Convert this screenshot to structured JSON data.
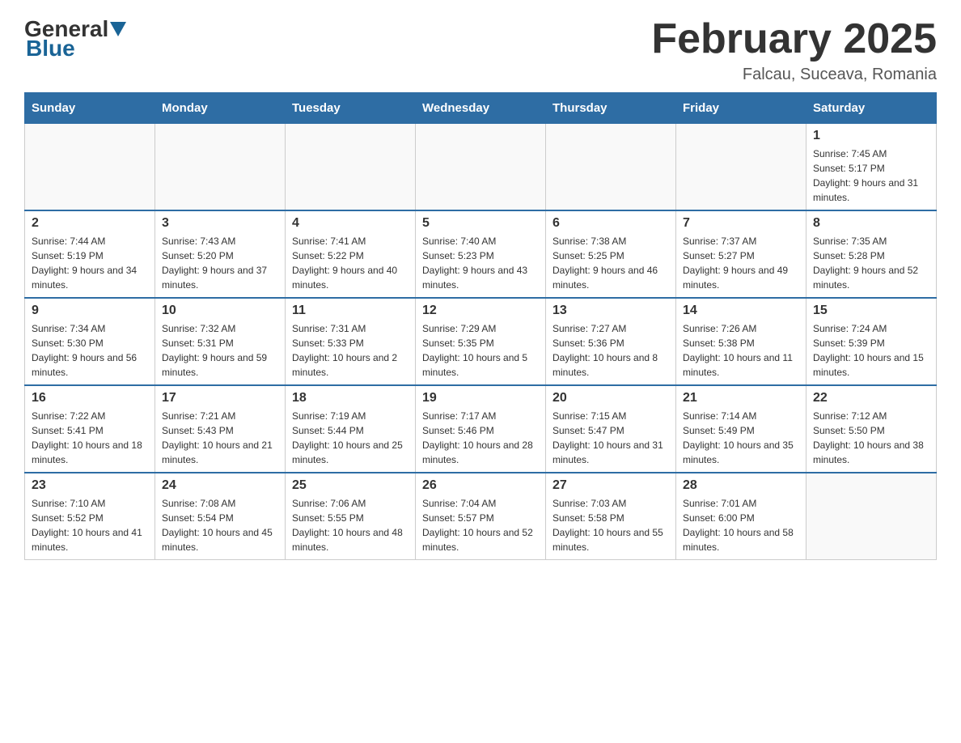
{
  "header": {
    "logo_general": "General",
    "logo_blue": "Blue",
    "month_title": "February 2025",
    "location": "Falcau, Suceava, Romania"
  },
  "weekdays": [
    "Sunday",
    "Monday",
    "Tuesday",
    "Wednesday",
    "Thursday",
    "Friday",
    "Saturday"
  ],
  "weeks": [
    [
      {
        "day": "",
        "info": ""
      },
      {
        "day": "",
        "info": ""
      },
      {
        "day": "",
        "info": ""
      },
      {
        "day": "",
        "info": ""
      },
      {
        "day": "",
        "info": ""
      },
      {
        "day": "",
        "info": ""
      },
      {
        "day": "1",
        "info": "Sunrise: 7:45 AM\nSunset: 5:17 PM\nDaylight: 9 hours and 31 minutes."
      }
    ],
    [
      {
        "day": "2",
        "info": "Sunrise: 7:44 AM\nSunset: 5:19 PM\nDaylight: 9 hours and 34 minutes."
      },
      {
        "day": "3",
        "info": "Sunrise: 7:43 AM\nSunset: 5:20 PM\nDaylight: 9 hours and 37 minutes."
      },
      {
        "day": "4",
        "info": "Sunrise: 7:41 AM\nSunset: 5:22 PM\nDaylight: 9 hours and 40 minutes."
      },
      {
        "day": "5",
        "info": "Sunrise: 7:40 AM\nSunset: 5:23 PM\nDaylight: 9 hours and 43 minutes."
      },
      {
        "day": "6",
        "info": "Sunrise: 7:38 AM\nSunset: 5:25 PM\nDaylight: 9 hours and 46 minutes."
      },
      {
        "day": "7",
        "info": "Sunrise: 7:37 AM\nSunset: 5:27 PM\nDaylight: 9 hours and 49 minutes."
      },
      {
        "day": "8",
        "info": "Sunrise: 7:35 AM\nSunset: 5:28 PM\nDaylight: 9 hours and 52 minutes."
      }
    ],
    [
      {
        "day": "9",
        "info": "Sunrise: 7:34 AM\nSunset: 5:30 PM\nDaylight: 9 hours and 56 minutes."
      },
      {
        "day": "10",
        "info": "Sunrise: 7:32 AM\nSunset: 5:31 PM\nDaylight: 9 hours and 59 minutes."
      },
      {
        "day": "11",
        "info": "Sunrise: 7:31 AM\nSunset: 5:33 PM\nDaylight: 10 hours and 2 minutes."
      },
      {
        "day": "12",
        "info": "Sunrise: 7:29 AM\nSunset: 5:35 PM\nDaylight: 10 hours and 5 minutes."
      },
      {
        "day": "13",
        "info": "Sunrise: 7:27 AM\nSunset: 5:36 PM\nDaylight: 10 hours and 8 minutes."
      },
      {
        "day": "14",
        "info": "Sunrise: 7:26 AM\nSunset: 5:38 PM\nDaylight: 10 hours and 11 minutes."
      },
      {
        "day": "15",
        "info": "Sunrise: 7:24 AM\nSunset: 5:39 PM\nDaylight: 10 hours and 15 minutes."
      }
    ],
    [
      {
        "day": "16",
        "info": "Sunrise: 7:22 AM\nSunset: 5:41 PM\nDaylight: 10 hours and 18 minutes."
      },
      {
        "day": "17",
        "info": "Sunrise: 7:21 AM\nSunset: 5:43 PM\nDaylight: 10 hours and 21 minutes."
      },
      {
        "day": "18",
        "info": "Sunrise: 7:19 AM\nSunset: 5:44 PM\nDaylight: 10 hours and 25 minutes."
      },
      {
        "day": "19",
        "info": "Sunrise: 7:17 AM\nSunset: 5:46 PM\nDaylight: 10 hours and 28 minutes."
      },
      {
        "day": "20",
        "info": "Sunrise: 7:15 AM\nSunset: 5:47 PM\nDaylight: 10 hours and 31 minutes."
      },
      {
        "day": "21",
        "info": "Sunrise: 7:14 AM\nSunset: 5:49 PM\nDaylight: 10 hours and 35 minutes."
      },
      {
        "day": "22",
        "info": "Sunrise: 7:12 AM\nSunset: 5:50 PM\nDaylight: 10 hours and 38 minutes."
      }
    ],
    [
      {
        "day": "23",
        "info": "Sunrise: 7:10 AM\nSunset: 5:52 PM\nDaylight: 10 hours and 41 minutes."
      },
      {
        "day": "24",
        "info": "Sunrise: 7:08 AM\nSunset: 5:54 PM\nDaylight: 10 hours and 45 minutes."
      },
      {
        "day": "25",
        "info": "Sunrise: 7:06 AM\nSunset: 5:55 PM\nDaylight: 10 hours and 48 minutes."
      },
      {
        "day": "26",
        "info": "Sunrise: 7:04 AM\nSunset: 5:57 PM\nDaylight: 10 hours and 52 minutes."
      },
      {
        "day": "27",
        "info": "Sunrise: 7:03 AM\nSunset: 5:58 PM\nDaylight: 10 hours and 55 minutes."
      },
      {
        "day": "28",
        "info": "Sunrise: 7:01 AM\nSunset: 6:00 PM\nDaylight: 10 hours and 58 minutes."
      },
      {
        "day": "",
        "info": ""
      }
    ]
  ],
  "colors": {
    "header_bg": "#2e6da4",
    "header_text": "#ffffff",
    "accent_blue": "#1a6496"
  }
}
